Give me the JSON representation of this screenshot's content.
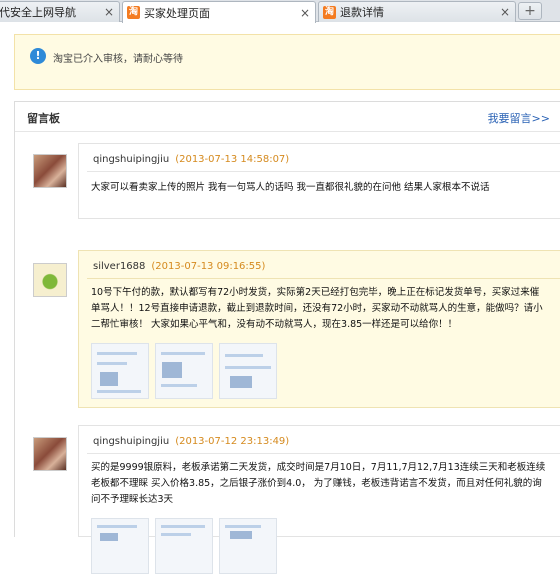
{
  "tabs": [
    {
      "label": "代安全上网导航",
      "has_icon": false,
      "active": false
    },
    {
      "label": "买家处理页面",
      "has_icon": true,
      "active": true
    },
    {
      "label": "退款详情",
      "has_icon": true,
      "active": false
    }
  ],
  "tab_icon_text": "淘",
  "close_glyph": "×",
  "new_tab_glyph": "+",
  "notice": {
    "icon": "!",
    "text": "淘宝已介入审核，请耐心等待"
  },
  "board": {
    "title": "留言板",
    "reply_link": "我要留言>>"
  },
  "messages": [
    {
      "user": "qingshuipingjiu",
      "time": "(2013-07-13 14:58:07)",
      "content": "大家可以看卖家上传的照片 我有一句骂人的话吗 我一直都很礼貌的在问他 结果人家根本不说话"
    },
    {
      "user": "silver1688",
      "time": "(2013-07-13 09:16:55)",
      "content": "10号下午付的款，默认都写有72小时发货，实际第2天已经打包完毕，晚上正在标记发货单号，买家过来催单骂人！！12号直接申请退款，截止到退款时间，还没有72小时，买家动不动就骂人的生意，能做吗？请小二帮忙审核！ 大家如果心平气和，没有动不动就骂人，现在3.85一样还是可以给你！！"
    },
    {
      "user": "qingshuipingjiu",
      "time": "(2013-07-12 23:13:49)",
      "content": "买的是9999银原料，老板承诺第二天发货，成交时间是7月10日，7月11,7月12,7月13连续三天和老板连续老板都不理睬 买入价格3.85，之后银子涨价到4.0， 为了赚钱，老板违背诺言不发货，而且对任何礼貌的询问不予理睬长达3天"
    }
  ],
  "colors": {
    "link": "#2a62b5",
    "time": "#d58a1e",
    "notice_bg": "#fffbe3"
  }
}
